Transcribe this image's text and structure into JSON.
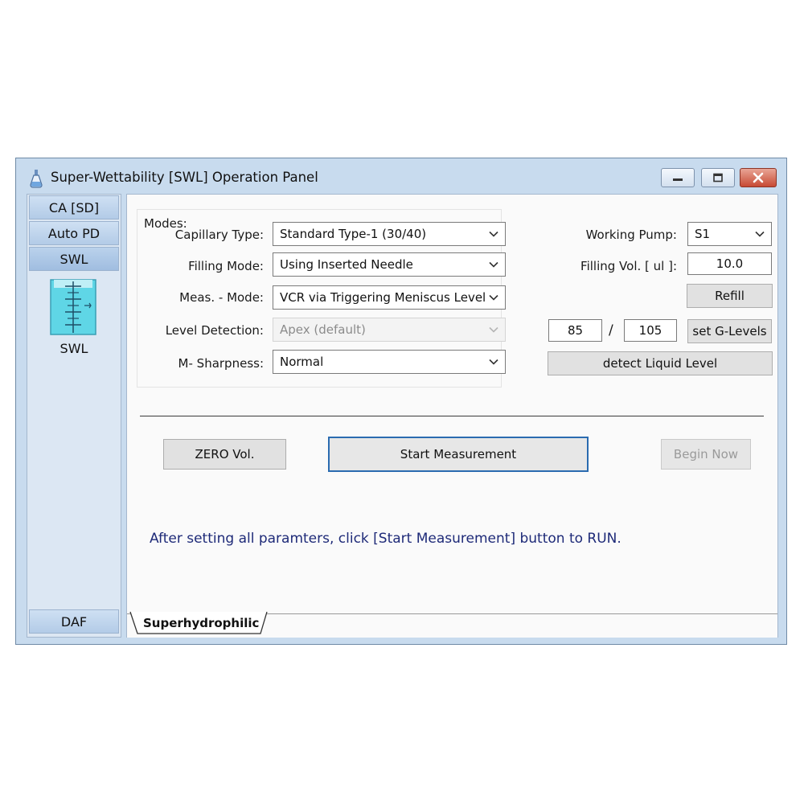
{
  "window": {
    "title": "Super-Wettability [SWL] Operation Panel"
  },
  "sidebar": {
    "items": [
      {
        "label": "CA [SD]"
      },
      {
        "label": "Auto PD"
      },
      {
        "label": "SWL"
      }
    ],
    "current_label": "SWL",
    "bottom_item": {
      "label": "DAF"
    }
  },
  "modes": {
    "title": "Modes:",
    "capillary_type": {
      "label": "Capillary Type:",
      "value": "Standard Type-1 (30/40)"
    },
    "filling_mode": {
      "label": "Filling Mode:",
      "value": "Using Inserted Needle"
    },
    "meas_mode": {
      "label": "Meas. - Mode:",
      "value": "VCR via Triggering Meniscus Level"
    },
    "level_detection": {
      "label": "Level Detection:",
      "value": "Apex (default)"
    },
    "m_sharpness": {
      "label": "M- Sharpness:",
      "value": "Normal"
    }
  },
  "pump": {
    "working_pump": {
      "label": "Working Pump:",
      "value": "S1"
    },
    "filling_vol": {
      "label": "Filling Vol. [ ul ]:",
      "value": "10.0"
    },
    "refill_label": "Refill",
    "g_level_low": "85",
    "g_level_sep": "/",
    "g_level_high": "105",
    "set_g_levels_label": "set G-Levels",
    "detect_label": "detect Liquid Level"
  },
  "actions": {
    "zero_label": "ZERO Vol.",
    "start_label": "Start Measurement",
    "begin_label": "Begin Now"
  },
  "info_text": "After setting all paramters, click [Start Measurement] button to RUN.",
  "tabs": [
    {
      "label": "Superhydrophilic"
    }
  ],
  "colors": {
    "accent": "#2a6bb0",
    "info_text": "#1e2a78",
    "window_frame": "#c8dbee",
    "close_button": "#c74a34"
  }
}
